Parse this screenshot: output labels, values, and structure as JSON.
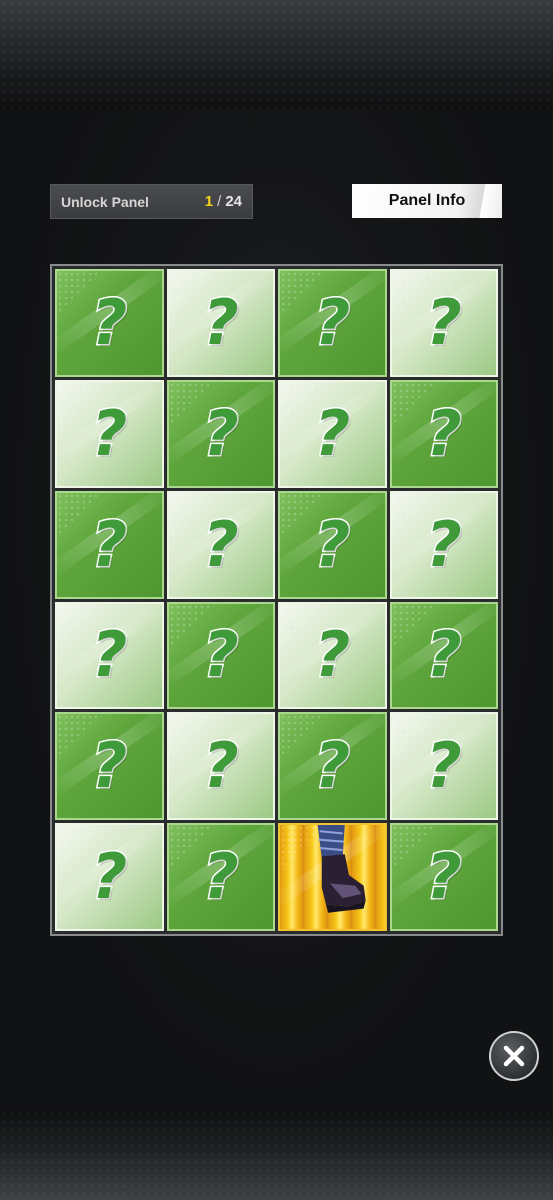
{
  "unlock": {
    "label": "Unlock Panel",
    "current": "1",
    "separator": "/",
    "total": "24"
  },
  "panel_info": {
    "label": "Panel Info"
  },
  "grid": {
    "rows": 6,
    "columns": 4,
    "hidden_symbol": "?",
    "tiles": [
      {
        "state": "hidden",
        "shade": "dark"
      },
      {
        "state": "hidden",
        "shade": "light"
      },
      {
        "state": "hidden",
        "shade": "dark"
      },
      {
        "state": "hidden",
        "shade": "light"
      },
      {
        "state": "hidden",
        "shade": "light"
      },
      {
        "state": "hidden",
        "shade": "dark"
      },
      {
        "state": "hidden",
        "shade": "light"
      },
      {
        "state": "hidden",
        "shade": "dark"
      },
      {
        "state": "hidden",
        "shade": "dark"
      },
      {
        "state": "hidden",
        "shade": "light"
      },
      {
        "state": "hidden",
        "shade": "dark"
      },
      {
        "state": "hidden",
        "shade": "light"
      },
      {
        "state": "hidden",
        "shade": "light"
      },
      {
        "state": "hidden",
        "shade": "dark"
      },
      {
        "state": "hidden",
        "shade": "light"
      },
      {
        "state": "hidden",
        "shade": "dark"
      },
      {
        "state": "hidden",
        "shade": "dark"
      },
      {
        "state": "hidden",
        "shade": "light"
      },
      {
        "state": "hidden",
        "shade": "dark"
      },
      {
        "state": "hidden",
        "shade": "light"
      },
      {
        "state": "hidden",
        "shade": "light"
      },
      {
        "state": "hidden",
        "shade": "dark"
      },
      {
        "state": "revealed",
        "shade": "gold",
        "content": "boot-art"
      },
      {
        "state": "hidden",
        "shade": "dark"
      }
    ]
  },
  "colors": {
    "dark_tile": "#5ea63c",
    "light_tile": "#d6e8c8",
    "question_mark": "#3f9a3a",
    "counter_highlight": "#f2d31b",
    "revealed_gold": "#f6c81a"
  },
  "icons": {
    "close": "close-icon",
    "question": "question-mark-icon"
  }
}
